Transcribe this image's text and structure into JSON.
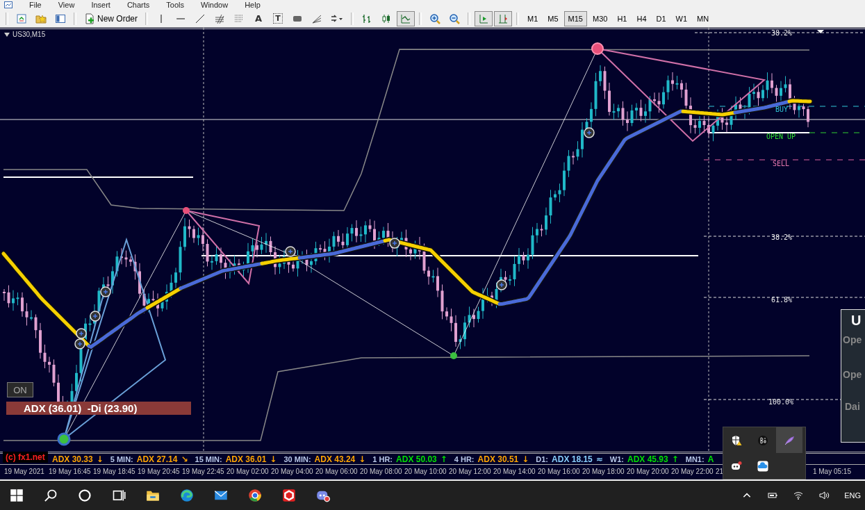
{
  "menu": [
    "File",
    "View",
    "Insert",
    "Charts",
    "Tools",
    "Window",
    "Help"
  ],
  "toolbar": {
    "groups": [
      [
        {
          "kind": "market-watch",
          "selected": false
        },
        {
          "kind": "favorites",
          "selected": false
        },
        {
          "kind": "navigator",
          "selected": false
        }
      ],
      [
        {
          "kind": "new-order",
          "label": "New Order",
          "selected": false
        }
      ],
      [
        {
          "kind": "vline",
          "selected": false
        },
        {
          "kind": "hline",
          "selected": false
        },
        {
          "kind": "trendline",
          "selected": false
        },
        {
          "kind": "fibo",
          "selected": false
        },
        {
          "kind": "grid",
          "selected": false
        },
        {
          "kind": "text",
          "glyph": "A",
          "selected": false
        },
        {
          "kind": "label",
          "glyph": "T",
          "selected": false
        },
        {
          "kind": "rect",
          "selected": false
        },
        {
          "kind": "fan",
          "selected": false
        },
        {
          "kind": "arrows",
          "selected": false
        }
      ],
      [
        {
          "kind": "bars",
          "selected": false
        },
        {
          "kind": "candles",
          "selected": false
        },
        {
          "kind": "line",
          "selected": true
        }
      ],
      [
        {
          "kind": "zoom-in",
          "selected": false
        },
        {
          "kind": "zoom-out",
          "selected": false
        }
      ],
      [
        {
          "kind": "autoscroll",
          "selected": true
        },
        {
          "kind": "shift",
          "selected": true
        }
      ]
    ],
    "timeframes": [
      {
        "label": "M1",
        "selected": false
      },
      {
        "label": "M5",
        "selected": false
      },
      {
        "label": "M15",
        "selected": true
      },
      {
        "label": "M30",
        "selected": false
      },
      {
        "label": "H1",
        "selected": false
      },
      {
        "label": "H4",
        "selected": false
      },
      {
        "label": "D1",
        "selected": false
      },
      {
        "label": "W1",
        "selected": false
      },
      {
        "label": "MN",
        "selected": false
      }
    ]
  },
  "chart": {
    "symbol": "US30,M15",
    "levels": [
      "38.2%",
      "38.2%",
      "61.8%",
      "100.0%"
    ],
    "signals": [
      {
        "label": "BUY",
        "kind": "buy"
      },
      {
        "label": "OPEN UP",
        "kind": "open-up"
      },
      {
        "label": "SELL",
        "kind": "sell"
      }
    ],
    "toggle": "ON",
    "adx_box": "ADX (36.01)  -Di (23.90)",
    "side_panel": [
      "U",
      "Ope",
      "Ope",
      "Dai"
    ]
  },
  "adx_strip": {
    "logo": "(c) fx1.net",
    "items": [
      {
        "value": "ADX 30.33",
        "color": "#ffa500",
        "arrow": "↓"
      },
      {
        "label": "5 MIN:",
        "value": "ADX 27.14",
        "color": "#ffa500",
        "arrow": "↘"
      },
      {
        "label": "15 MIN:",
        "value": "ADX 36.01",
        "color": "#ffa500",
        "arrow": "↓"
      },
      {
        "label": "30 MIN:",
        "value": "ADX 43.24",
        "color": "#ffa500",
        "arrow": "↓"
      },
      {
        "label": "1 HR:",
        "value": "ADX 50.03",
        "color": "#00e000",
        "arrow": "↑"
      },
      {
        "label": "4 HR:",
        "value": "ADX 30.51",
        "color": "#ffa500",
        "arrow": "↓"
      },
      {
        "label": "D1:",
        "value": "ADX 18.15",
        "color": "#87cefa",
        "arrow": "≈"
      },
      {
        "label": "W1:",
        "value": "ADX 45.93",
        "color": "#00e000",
        "arrow": "↑"
      },
      {
        "label": "MN1:",
        "value": "A",
        "color": "#00e000"
      }
    ]
  },
  "time_axis": [
    "19 May 2021",
    "19 May 16:45",
    "19 May 18:45",
    "19 May 20:45",
    "19 May 22:45",
    "20 May 02:00",
    "20 May 04:00",
    "20 May 06:00",
    "20 May 08:00",
    "20 May 10:00",
    "20 May 12:00",
    "20 May 14:00",
    "20 May 16:00",
    "20 May 18:00",
    "20 May 20:00",
    "20 May 22:00",
    "21",
    "1 May 05:15"
  ],
  "tray_popup": [
    {
      "kind": "shield",
      "selected": false
    },
    {
      "kind": "bo",
      "selected": false
    },
    {
      "kind": "feather",
      "selected": true
    },
    {
      "kind": "chat",
      "selected": false
    },
    {
      "kind": "cloud",
      "selected": false
    }
  ],
  "taskbar": {
    "language": "ENG"
  }
}
